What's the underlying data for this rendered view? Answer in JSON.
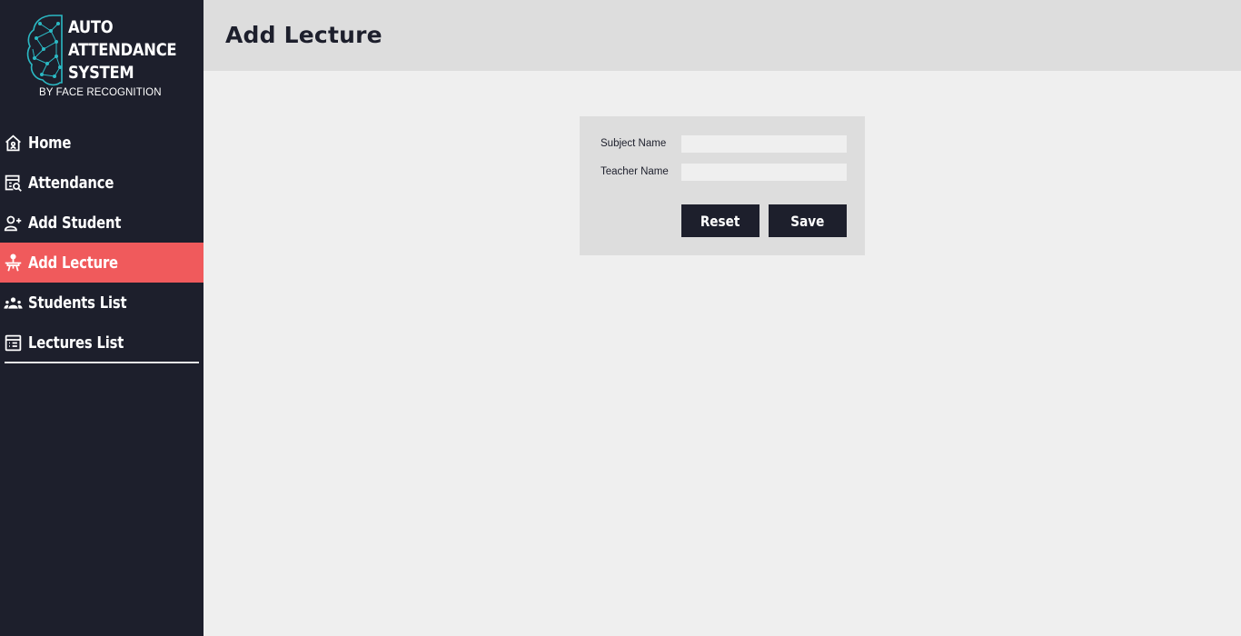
{
  "logo": {
    "title_lines": [
      "AUTO",
      "ATTENDANCE",
      "SYSTEM"
    ],
    "subtitle": "BY FACE RECOGNITION"
  },
  "sidebar": {
    "items": [
      {
        "label": "Home",
        "icon": "home-icon"
      },
      {
        "label": "Attendance",
        "icon": "attendance-search-icon"
      },
      {
        "label": "Add Student",
        "icon": "add-user-icon"
      },
      {
        "label": "Add Lecture",
        "icon": "lecture-icon",
        "active": true
      },
      {
        "label": "Students List",
        "icon": "group-icon"
      },
      {
        "label": "Lectures List",
        "icon": "list-icon"
      }
    ]
  },
  "header": {
    "title": "Add Lecture"
  },
  "form": {
    "subject_label": "Subject Name",
    "subject_value": "",
    "teacher_label": "Teacher Name",
    "teacher_value": "",
    "reset_label": "Reset",
    "save_label": "Save"
  },
  "colors": {
    "sidebar_bg": "#1d1f2c",
    "accent": "#f05a5c",
    "logo_teal": "#2bb9c4",
    "header_bg": "#dddddd",
    "content_bg": "#efefef"
  }
}
